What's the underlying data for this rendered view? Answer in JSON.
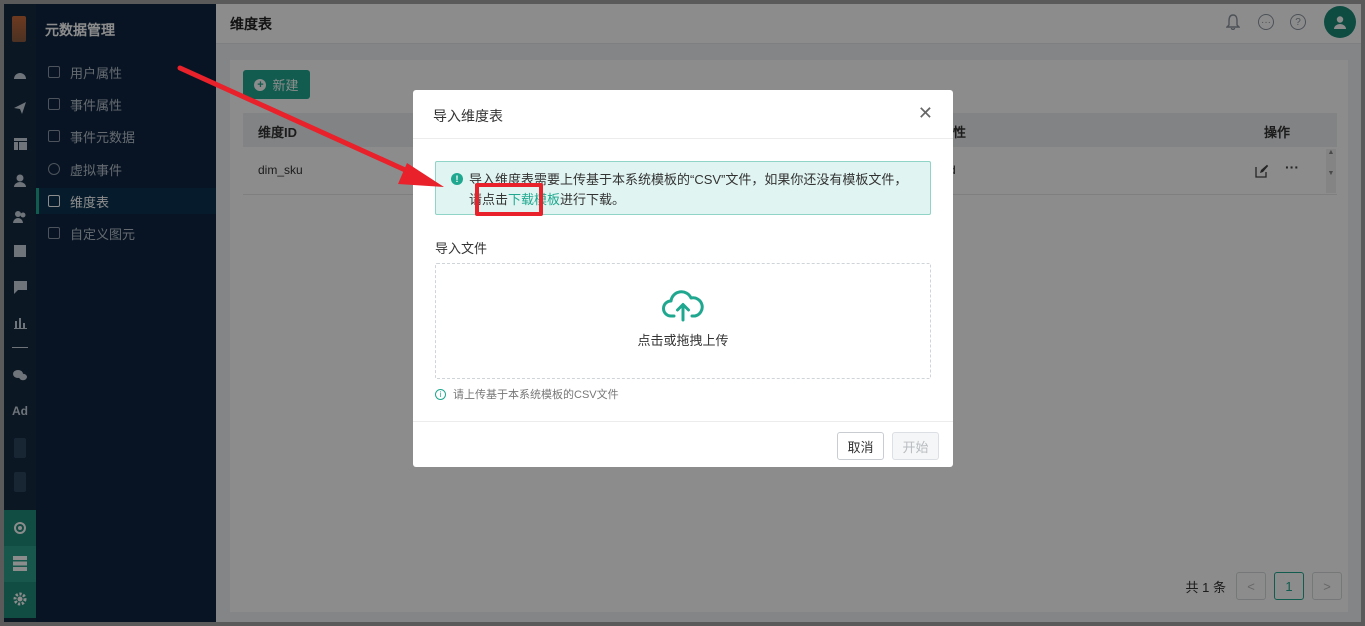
{
  "sidebar": {
    "title": "元数据管理",
    "items": [
      {
        "label": "用户属性"
      },
      {
        "label": "事件属性"
      },
      {
        "label": "事件元数据"
      },
      {
        "label": "虚拟事件"
      },
      {
        "label": "维度表"
      },
      {
        "label": "自定义图元"
      }
    ]
  },
  "rail": {
    "ad_label": "Ad"
  },
  "header": {
    "title": "维度表"
  },
  "toolbar": {
    "new_label": "新建"
  },
  "table": {
    "headers": [
      "维度ID",
      "性",
      "操作"
    ],
    "rows": [
      {
        "id": "dim_sku",
        "col2": "d"
      }
    ]
  },
  "pagination": {
    "total": "共 1 条",
    "current": "1",
    "prev": "<",
    "next": ">"
  },
  "modal": {
    "title": "导入维度表",
    "alert_before": "导入维度表需要上传基于本系统模板的“CSV”文件，如果你还没有模板文件，请点击",
    "alert_link": "下载模板",
    "alert_after": "进行下载。",
    "file_label": "导入文件",
    "upload_text": "点击或拖拽上传",
    "hint": "请上传基于本系统模板的CSV文件",
    "cancel_label": "取消",
    "start_label": "开始"
  },
  "colors": {
    "accent": "#1fa88f",
    "sidebar_bg": "#102640",
    "annotation_red": "#e8212b"
  }
}
